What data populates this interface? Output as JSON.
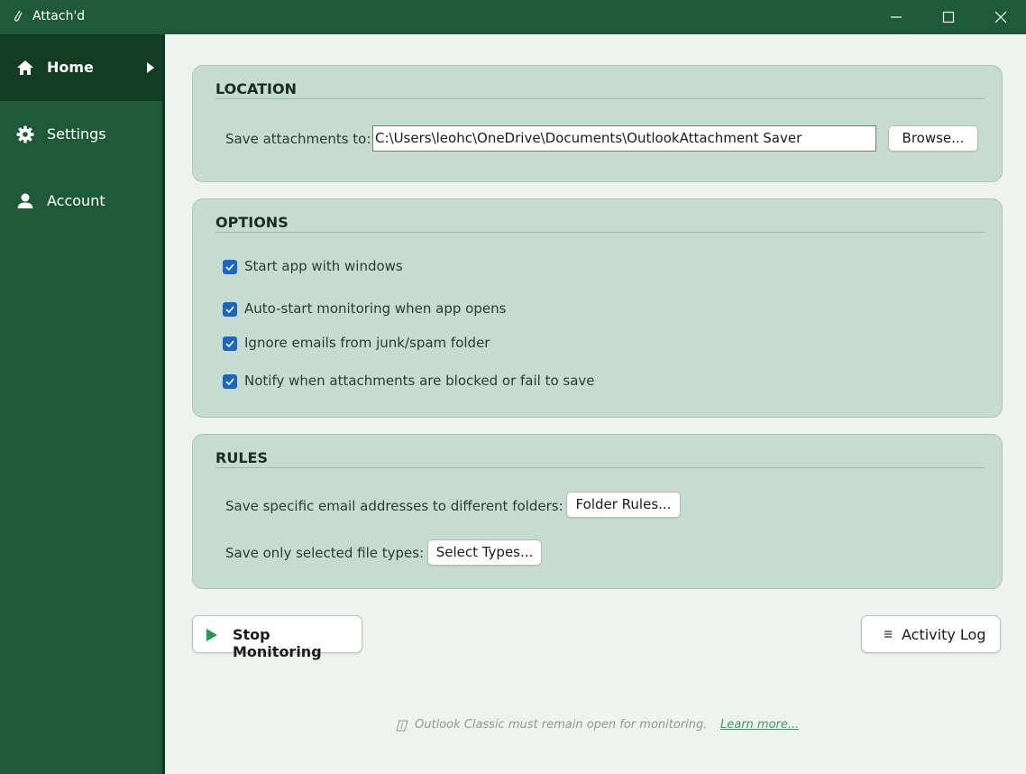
{
  "window": {
    "title": "Attach'd",
    "app_icon": "paperclip-icon",
    "controls": [
      "minimize-icon",
      "maximize-icon",
      "close-icon"
    ]
  },
  "sidebar": {
    "items": [
      {
        "label": "Home",
        "icon": "home-icon",
        "active": true
      },
      {
        "label": "Settings",
        "icon": "gear-icon",
        "active": false
      },
      {
        "label": "Account",
        "icon": "person-icon",
        "active": false
      }
    ]
  },
  "location": {
    "title": "LOCATION",
    "save_label": "Save attachments to:",
    "path": "C:\\Users\\leohc\\OneDrive\\Documents\\OutlookAttachment Saver",
    "browse_label": "Browse..."
  },
  "options": {
    "title": "OPTIONS",
    "items": [
      {
        "label": "Start app with windows",
        "checked": true
      },
      {
        "label": "Auto-start monitoring when app opens",
        "checked": true
      },
      {
        "label": "Ignore emails from junk/spam folder",
        "checked": true
      },
      {
        "label": "Notify when attachments are blocked or fail to save",
        "checked": true
      }
    ]
  },
  "rules": {
    "title": "RULES",
    "folder_rules_text": "Save specific email addresses to different folders:",
    "folder_rules_button": "Folder Rules...",
    "file_types_text": "Save only selected file types:",
    "file_types_button": "Select Types..."
  },
  "actions": {
    "stop_label": "Stop Monitoring",
    "log_label": "Activity Log"
  },
  "footer": {
    "note": "Outlook Classic must remain open for monitoring.",
    "link": "Learn more..."
  },
  "colors": {
    "sidebar": "#1e5a38",
    "sidebar_active": "#123d24",
    "card": "#c7dcd0",
    "checkbox": "#1a66c2",
    "play": "#1f9a4a",
    "link": "#3c9a63"
  }
}
